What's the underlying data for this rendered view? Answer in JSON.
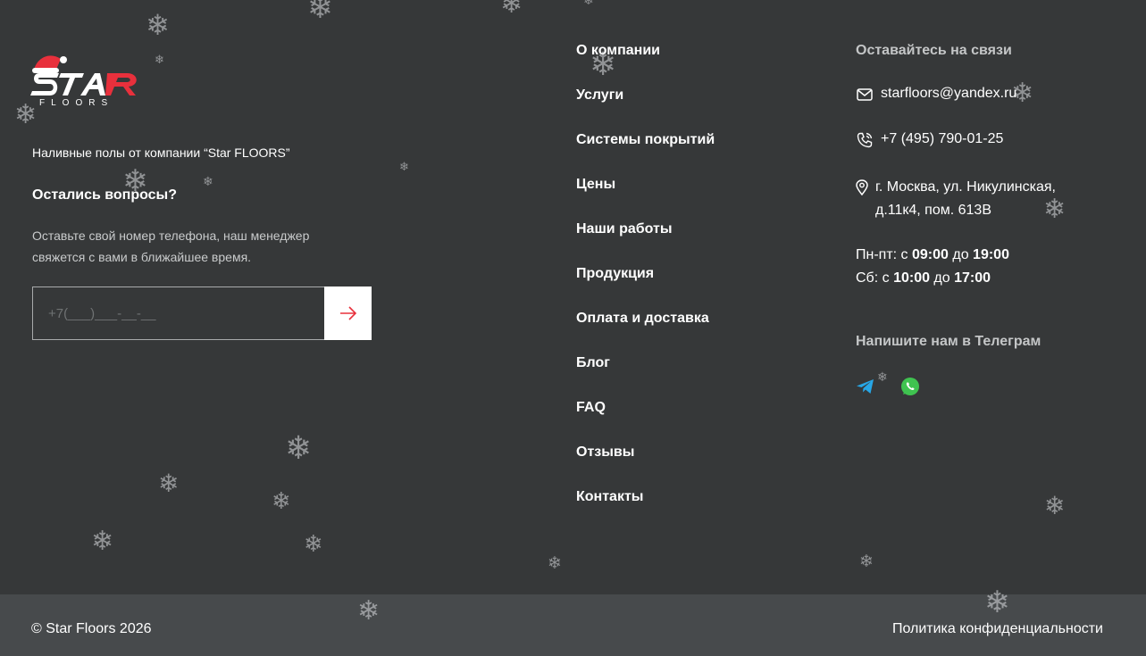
{
  "brand": {
    "logo_text": "STAR",
    "logo_sub": "FLOORS",
    "tagline": "Наливные полы от компании “Star FLOORS”"
  },
  "callback": {
    "title": "Остались вопросы?",
    "description": "Оставьте свой номер телефона, наш менеджер свяжется с вами в ближайшее время.",
    "phone_placeholder": "+7(___)___-__-__"
  },
  "nav": {
    "items": [
      "О компании",
      "Услуги",
      "Системы покрытий",
      "Цены",
      "Наши работы",
      "Продукция",
      "Оплата и доставка",
      "Блог",
      "FAQ",
      "Отзывы",
      "Контакты"
    ]
  },
  "contacts": {
    "title": "Оставайтесь на связи",
    "email": "starfloors@yandex.ru",
    "phone": "+7 (495) 790-01-25",
    "address_line1": "г. Москва, ул. Никулинская,",
    "address_line2": "д.11к4, пом. 613В",
    "hours_weekday_prefix": "Пн-пт: с ",
    "hours_weekday_from": "09:00",
    "hours_weekday_mid": " до ",
    "hours_weekday_to": "19:00",
    "hours_sat_prefix": "Сб: с ",
    "hours_sat_from": "10:00",
    "hours_sat_mid": " до ",
    "hours_sat_to": "17:00",
    "telegram_title": "Напишите нам в Телеграм"
  },
  "social": {
    "telegram_icon": "telegram-icon",
    "whatsapp_icon": "whatsapp-icon"
  },
  "footer": {
    "copyright": "© Star Floors 2026",
    "privacy": "Политика конфиденциальности"
  },
  "colors": {
    "background": "#363839",
    "bottom_bar": "#474a4c",
    "accent_red": "#e8303c",
    "telegram": "#27a7e7",
    "whatsapp": "#3fc350"
  }
}
